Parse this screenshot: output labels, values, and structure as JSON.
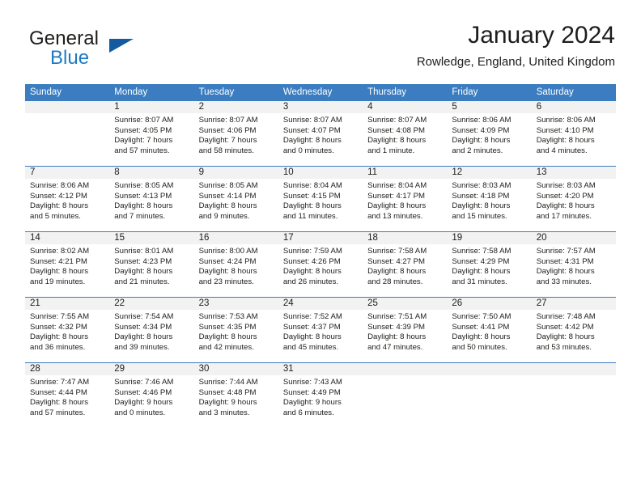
{
  "brand": {
    "name_part1": "General",
    "name_part2": "Blue",
    "triangle_color": "#135b9e",
    "blue_color": "#1f7ac4"
  },
  "header": {
    "title": "January 2024",
    "subtitle": "Rowledge, England, United Kingdom"
  },
  "theme": {
    "header_row_bg": "#3b7dc0",
    "daynum_bg": "#f2f2f2",
    "text": "#1d1d1b"
  },
  "weekday_headers": [
    "Sunday",
    "Monday",
    "Tuesday",
    "Wednesday",
    "Thursday",
    "Friday",
    "Saturday"
  ],
  "weeks": [
    [
      {
        "day": "",
        "sunrise": "",
        "sunset": "",
        "daylight1": "",
        "daylight2": "",
        "blank": true
      },
      {
        "day": "1",
        "sunrise": "Sunrise: 8:07 AM",
        "sunset": "Sunset: 4:05 PM",
        "daylight1": "Daylight: 7 hours",
        "daylight2": "and 57 minutes.",
        "blank": false
      },
      {
        "day": "2",
        "sunrise": "Sunrise: 8:07 AM",
        "sunset": "Sunset: 4:06 PM",
        "daylight1": "Daylight: 7 hours",
        "daylight2": "and 58 minutes.",
        "blank": false
      },
      {
        "day": "3",
        "sunrise": "Sunrise: 8:07 AM",
        "sunset": "Sunset: 4:07 PM",
        "daylight1": "Daylight: 8 hours",
        "daylight2": "and 0 minutes.",
        "blank": false
      },
      {
        "day": "4",
        "sunrise": "Sunrise: 8:07 AM",
        "sunset": "Sunset: 4:08 PM",
        "daylight1": "Daylight: 8 hours",
        "daylight2": "and 1 minute.",
        "blank": false
      },
      {
        "day": "5",
        "sunrise": "Sunrise: 8:06 AM",
        "sunset": "Sunset: 4:09 PM",
        "daylight1": "Daylight: 8 hours",
        "daylight2": "and 2 minutes.",
        "blank": false
      },
      {
        "day": "6",
        "sunrise": "Sunrise: 8:06 AM",
        "sunset": "Sunset: 4:10 PM",
        "daylight1": "Daylight: 8 hours",
        "daylight2": "and 4 minutes.",
        "blank": false
      }
    ],
    [
      {
        "day": "7",
        "sunrise": "Sunrise: 8:06 AM",
        "sunset": "Sunset: 4:12 PM",
        "daylight1": "Daylight: 8 hours",
        "daylight2": "and 5 minutes.",
        "blank": false
      },
      {
        "day": "8",
        "sunrise": "Sunrise: 8:05 AM",
        "sunset": "Sunset: 4:13 PM",
        "daylight1": "Daylight: 8 hours",
        "daylight2": "and 7 minutes.",
        "blank": false
      },
      {
        "day": "9",
        "sunrise": "Sunrise: 8:05 AM",
        "sunset": "Sunset: 4:14 PM",
        "daylight1": "Daylight: 8 hours",
        "daylight2": "and 9 minutes.",
        "blank": false
      },
      {
        "day": "10",
        "sunrise": "Sunrise: 8:04 AM",
        "sunset": "Sunset: 4:15 PM",
        "daylight1": "Daylight: 8 hours",
        "daylight2": "and 11 minutes.",
        "blank": false
      },
      {
        "day": "11",
        "sunrise": "Sunrise: 8:04 AM",
        "sunset": "Sunset: 4:17 PM",
        "daylight1": "Daylight: 8 hours",
        "daylight2": "and 13 minutes.",
        "blank": false
      },
      {
        "day": "12",
        "sunrise": "Sunrise: 8:03 AM",
        "sunset": "Sunset: 4:18 PM",
        "daylight1": "Daylight: 8 hours",
        "daylight2": "and 15 minutes.",
        "blank": false
      },
      {
        "day": "13",
        "sunrise": "Sunrise: 8:03 AM",
        "sunset": "Sunset: 4:20 PM",
        "daylight1": "Daylight: 8 hours",
        "daylight2": "and 17 minutes.",
        "blank": false
      }
    ],
    [
      {
        "day": "14",
        "sunrise": "Sunrise: 8:02 AM",
        "sunset": "Sunset: 4:21 PM",
        "daylight1": "Daylight: 8 hours",
        "daylight2": "and 19 minutes.",
        "blank": false
      },
      {
        "day": "15",
        "sunrise": "Sunrise: 8:01 AM",
        "sunset": "Sunset: 4:23 PM",
        "daylight1": "Daylight: 8 hours",
        "daylight2": "and 21 minutes.",
        "blank": false
      },
      {
        "day": "16",
        "sunrise": "Sunrise: 8:00 AM",
        "sunset": "Sunset: 4:24 PM",
        "daylight1": "Daylight: 8 hours",
        "daylight2": "and 23 minutes.",
        "blank": false
      },
      {
        "day": "17",
        "sunrise": "Sunrise: 7:59 AM",
        "sunset": "Sunset: 4:26 PM",
        "daylight1": "Daylight: 8 hours",
        "daylight2": "and 26 minutes.",
        "blank": false
      },
      {
        "day": "18",
        "sunrise": "Sunrise: 7:58 AM",
        "sunset": "Sunset: 4:27 PM",
        "daylight1": "Daylight: 8 hours",
        "daylight2": "and 28 minutes.",
        "blank": false
      },
      {
        "day": "19",
        "sunrise": "Sunrise: 7:58 AM",
        "sunset": "Sunset: 4:29 PM",
        "daylight1": "Daylight: 8 hours",
        "daylight2": "and 31 minutes.",
        "blank": false
      },
      {
        "day": "20",
        "sunrise": "Sunrise: 7:57 AM",
        "sunset": "Sunset: 4:31 PM",
        "daylight1": "Daylight: 8 hours",
        "daylight2": "and 33 minutes.",
        "blank": false
      }
    ],
    [
      {
        "day": "21",
        "sunrise": "Sunrise: 7:55 AM",
        "sunset": "Sunset: 4:32 PM",
        "daylight1": "Daylight: 8 hours",
        "daylight2": "and 36 minutes.",
        "blank": false
      },
      {
        "day": "22",
        "sunrise": "Sunrise: 7:54 AM",
        "sunset": "Sunset: 4:34 PM",
        "daylight1": "Daylight: 8 hours",
        "daylight2": "and 39 minutes.",
        "blank": false
      },
      {
        "day": "23",
        "sunrise": "Sunrise: 7:53 AM",
        "sunset": "Sunset: 4:35 PM",
        "daylight1": "Daylight: 8 hours",
        "daylight2": "and 42 minutes.",
        "blank": false
      },
      {
        "day": "24",
        "sunrise": "Sunrise: 7:52 AM",
        "sunset": "Sunset: 4:37 PM",
        "daylight1": "Daylight: 8 hours",
        "daylight2": "and 45 minutes.",
        "blank": false
      },
      {
        "day": "25",
        "sunrise": "Sunrise: 7:51 AM",
        "sunset": "Sunset: 4:39 PM",
        "daylight1": "Daylight: 8 hours",
        "daylight2": "and 47 minutes.",
        "blank": false
      },
      {
        "day": "26",
        "sunrise": "Sunrise: 7:50 AM",
        "sunset": "Sunset: 4:41 PM",
        "daylight1": "Daylight: 8 hours",
        "daylight2": "and 50 minutes.",
        "blank": false
      },
      {
        "day": "27",
        "sunrise": "Sunrise: 7:48 AM",
        "sunset": "Sunset: 4:42 PM",
        "daylight1": "Daylight: 8 hours",
        "daylight2": "and 53 minutes.",
        "blank": false
      }
    ],
    [
      {
        "day": "28",
        "sunrise": "Sunrise: 7:47 AM",
        "sunset": "Sunset: 4:44 PM",
        "daylight1": "Daylight: 8 hours",
        "daylight2": "and 57 minutes.",
        "blank": false
      },
      {
        "day": "29",
        "sunrise": "Sunrise: 7:46 AM",
        "sunset": "Sunset: 4:46 PM",
        "daylight1": "Daylight: 9 hours",
        "daylight2": "and 0 minutes.",
        "blank": false
      },
      {
        "day": "30",
        "sunrise": "Sunrise: 7:44 AM",
        "sunset": "Sunset: 4:48 PM",
        "daylight1": "Daylight: 9 hours",
        "daylight2": "and 3 minutes.",
        "blank": false
      },
      {
        "day": "31",
        "sunrise": "Sunrise: 7:43 AM",
        "sunset": "Sunset: 4:49 PM",
        "daylight1": "Daylight: 9 hours",
        "daylight2": "and 6 minutes.",
        "blank": false
      },
      {
        "day": "",
        "sunrise": "",
        "sunset": "",
        "daylight1": "",
        "daylight2": "",
        "blank": true
      },
      {
        "day": "",
        "sunrise": "",
        "sunset": "",
        "daylight1": "",
        "daylight2": "",
        "blank": true
      },
      {
        "day": "",
        "sunrise": "",
        "sunset": "",
        "daylight1": "",
        "daylight2": "",
        "blank": true
      }
    ]
  ]
}
